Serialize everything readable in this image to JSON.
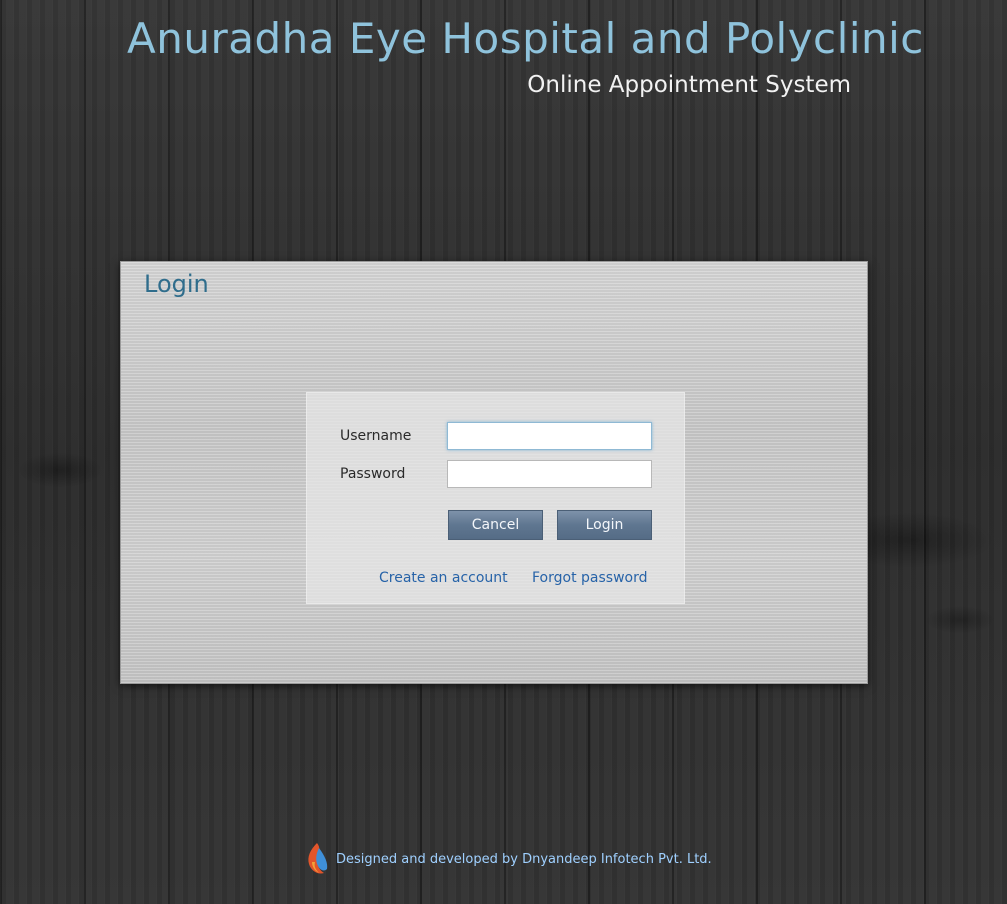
{
  "header": {
    "title": "Anuradha Eye Hospital and Polyclinic",
    "subtitle": "Online Appointment System"
  },
  "login": {
    "heading": "Login",
    "username_label": "Username",
    "username_value": "",
    "password_label": "Password",
    "password_value": "",
    "cancel_label": "Cancel",
    "login_label": "Login",
    "create_account_link": "Create an account",
    "forgot_password_link": "Forgot password"
  },
  "footer": {
    "credit_text": "Designed and developed by Dnyandeep Infotech Pvt. Ltd.",
    "logo_icon": "flame-logo-icon"
  },
  "colors": {
    "title": "#8fc3dc",
    "heading": "#2f6d8c",
    "link": "#2763a8",
    "button": "#5f7690",
    "footer_text": "#9fd0ff"
  }
}
